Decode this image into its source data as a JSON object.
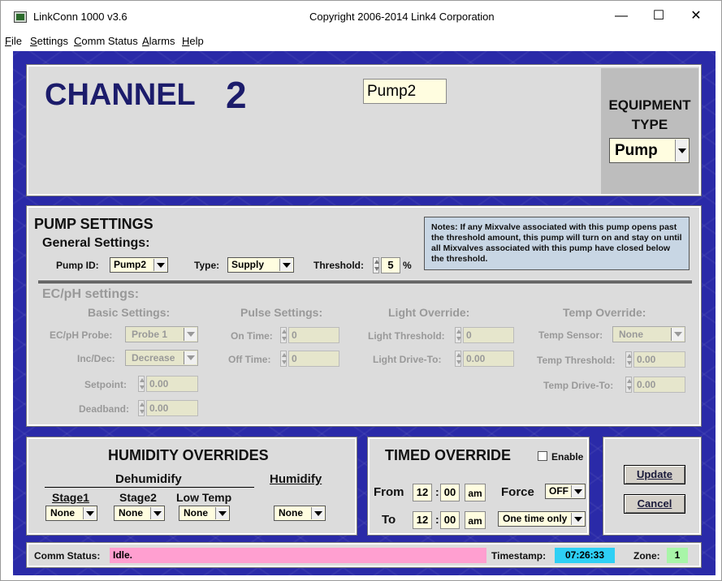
{
  "window": {
    "title": "LinkConn 1000 v3.6",
    "copyright": "Copyright 2006-2014 Link4 Corporation",
    "minimize": "—",
    "maximize": "☐",
    "close": "✕"
  },
  "menu": [
    "File",
    "Settings",
    "Comm Status",
    "Alarms",
    "Help"
  ],
  "channel": {
    "label": "CHANNEL",
    "number": "2",
    "name": "Pump2",
    "equipment_label_1": "EQUIPMENT",
    "equipment_label_2": "TYPE",
    "equipment_type": "Pump"
  },
  "pump": {
    "title": "PUMP SETTINGS",
    "general_title": "General Settings:",
    "pump_id_label": "Pump ID:",
    "pump_id": "Pump2",
    "type_label": "Type:",
    "type": "Supply",
    "threshold_label": "Threshold:",
    "threshold": "5",
    "threshold_unit": "%",
    "notes": "Notes: If any Mixvalve associated with this pump opens past the threshold amount, this pump will turn on and stay on until all Mixvalves associated with this pump have closed below the threshold."
  },
  "ecph": {
    "title": "EC/pH settings:",
    "basic_title": "Basic Settings:",
    "probe_label": "EC/pH Probe:",
    "probe": "Probe 1",
    "incdec_label": "Inc/Dec:",
    "incdec": "Decrease",
    "setpoint_label": "Setpoint:",
    "setpoint": "0.00",
    "deadband_label": "Deadband:",
    "deadband": "0.00",
    "pulse_title": "Pulse Settings:",
    "on_time_label": "On Time:",
    "on_time": "0",
    "off_time_label": "Off Time:",
    "off_time": "0",
    "light_title": "Light Override:",
    "light_threshold_label": "Light Threshold:",
    "light_threshold": "0",
    "light_drive_label": "Light Drive-To:",
    "light_drive": "0.00",
    "temp_title": "Temp Override:",
    "temp_sensor_label": "Temp Sensor:",
    "temp_sensor": "None",
    "temp_threshold_label": "Temp Threshold:",
    "temp_threshold": "0.00",
    "temp_drive_label": "Temp Drive-To:",
    "temp_drive": "0.00"
  },
  "humidity": {
    "title": "HUMIDITY OVERRIDES",
    "dehumidify": "Dehumidify",
    "humidify": "Humidify",
    "stage1": "Stage1",
    "stage2": "Stage2",
    "low_temp": "Low Temp",
    "stage1_value": "None",
    "stage2_value": "None",
    "low_temp_value": "None",
    "humidify_value": "None"
  },
  "timed": {
    "title": "TIMED OVERRIDE",
    "enable_label": "Enable",
    "from_label": "From",
    "to_label": "To",
    "from_hour": "12",
    "from_min": "00",
    "from_ampm": "am",
    "to_hour": "12",
    "to_min": "00",
    "to_ampm": "am",
    "colon": ":",
    "force_label": "Force",
    "force_value": "OFF",
    "mode_value": "One time only"
  },
  "buttons": {
    "update": "Update",
    "cancel": "Cancel"
  },
  "status": {
    "comm_label": "Comm Status:",
    "comm_value": "Idle.",
    "timestamp_label": "Timestamp:",
    "timestamp": "07:26:33",
    "zone_label": "Zone:",
    "zone": "1"
  },
  "colors": {
    "background_blue": "#2a2aa8",
    "panel_gray": "#dcdcdc",
    "field_yellow": "#fffde0",
    "comm_pink": "#ff9fd0",
    "timestamp_cyan": "#2ed0f5",
    "zone_green": "#a8f5a8",
    "title_navy": "#1c1c6b"
  }
}
